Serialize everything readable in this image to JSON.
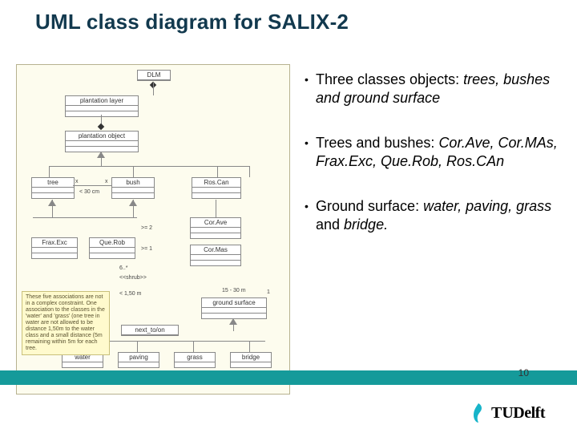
{
  "title": "UML class diagram for SALIX-2",
  "page_number": "10",
  "brand": {
    "t": "T",
    "u": "U",
    "rest": "Delft"
  },
  "bullets": [
    {
      "lead": "Three classes objects:",
      "em": "trees, bushes and ground surface"
    },
    {
      "lead": "Trees and bushes:",
      "em": "Cor.Ave, Cor.MAs, Frax.Exc, Que.Rob, Ros.CAn"
    },
    {
      "lead": "Ground surface:",
      "em": "water, paving, grass",
      "tail": " and ",
      "em2": "bridge."
    }
  ],
  "boxes": {
    "dlm": "DLM",
    "layer": "plantation layer",
    "object": "plantation object",
    "tree": "tree",
    "bush": "bush",
    "roscan": "Ros.Can",
    "corave": "Cor.Ave",
    "cormas": "Cor.Mas",
    "fraxexc": "Frax.Exc",
    "querob": "Que.Rob",
    "ground": "ground surface",
    "next": "next_to/on",
    "water": "water",
    "paving": "paving",
    "grass": "grass",
    "bridge": "bridge"
  },
  "labels": {
    "x": "x",
    "one": "1",
    "ge2": ">= 2",
    "ge1": ">= 1",
    "lt_30": "< 30 cm",
    "lt_1m": "< 1,50 m",
    "fifteen": "15 - 30 m",
    "sixcount": "6..*",
    "shrub": "<<shrub>>"
  },
  "note": "These five associations are not in a complex constraint. One association to the classes in the 'water' and 'grass' (one tree in water are not allowed to be distance 1,50m to the water class and a small distance (5m remaining within 5m for each tree."
}
